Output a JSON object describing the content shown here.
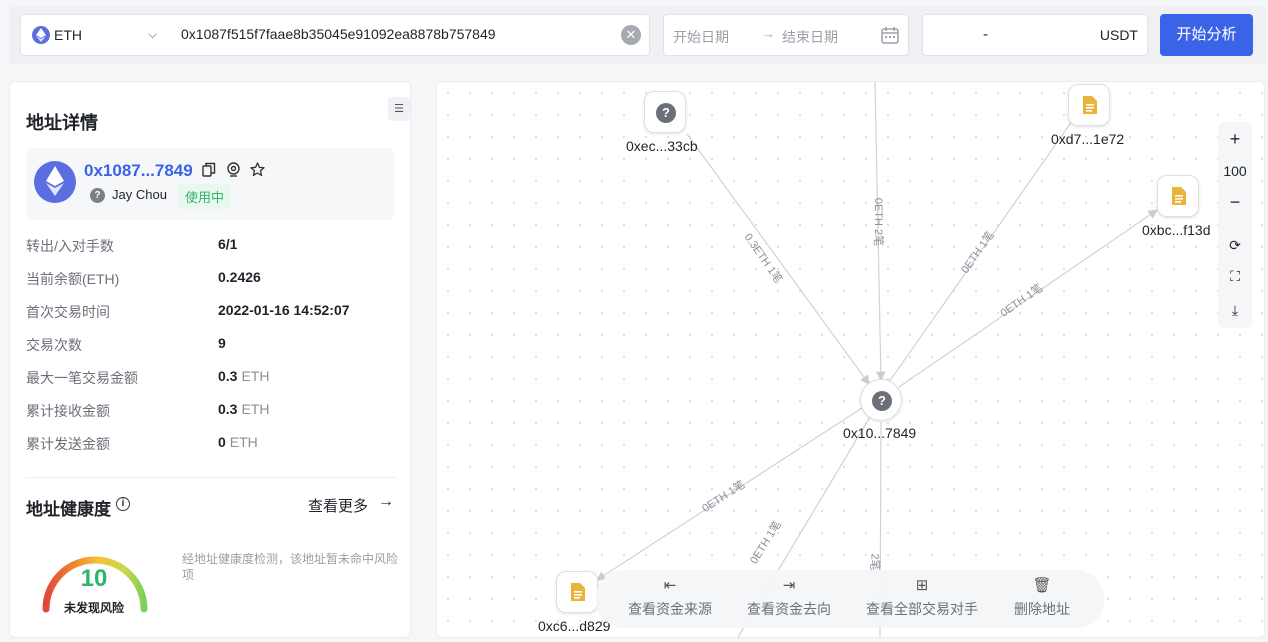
{
  "search": {
    "chain": "ETH",
    "address": "0x1087f515f7faae8b35045e91092ea8878b757849",
    "date_start_placeholder": "开始日期",
    "date_end_placeholder": "结束日期",
    "amount_min": "-",
    "amount_unit": "USDT",
    "analyze_label": "开始分析"
  },
  "detail": {
    "title": "地址详情",
    "address_short": "0x1087...7849",
    "tag_name": "Jay Chou",
    "status": "使用中",
    "rows": [
      {
        "label": "转出/入对手数",
        "value": "6/1",
        "unit": ""
      },
      {
        "label": "当前余额(ETH)",
        "value": "0.2426",
        "unit": ""
      },
      {
        "label": "首次交易时间",
        "value": "2022-01-16 14:52:07",
        "unit": ""
      },
      {
        "label": "交易次数",
        "value": "9",
        "unit": ""
      },
      {
        "label": "最大一笔交易金额",
        "value": "0.3",
        "unit": "ETH"
      },
      {
        "label": "累计接收金额",
        "value": "0.3",
        "unit": "ETH"
      },
      {
        "label": "累计发送金额",
        "value": "0",
        "unit": "ETH"
      }
    ]
  },
  "health": {
    "title": "地址健康度",
    "more": "查看更多",
    "score": "10",
    "score_level": 0.1,
    "risk_label": "未发现风险",
    "description": "经地址健康度检测，该地址暂未命中风险项"
  },
  "graph": {
    "nodes": [
      {
        "label": "0xec...33cb",
        "type": "unknown"
      },
      {
        "label": "0xd7...1e72",
        "type": "contract"
      },
      {
        "label": "0xbc...f13d",
        "type": "contract"
      },
      {
        "label": "0x10...7849",
        "type": "unknown"
      },
      {
        "label": "0xc6...d829",
        "type": "contract"
      }
    ],
    "edges": [
      "0.3ETH 1笔",
      "0ETH 2笔",
      "0ETH 1笔",
      "0ETH 1笔",
      "0ETH 1笔",
      "0ETH 1笔",
      "2笔"
    ],
    "zoom_level": "100",
    "actions": [
      "查看资金来源",
      "查看资金去向",
      "查看全部交易对手",
      "删除地址"
    ]
  }
}
